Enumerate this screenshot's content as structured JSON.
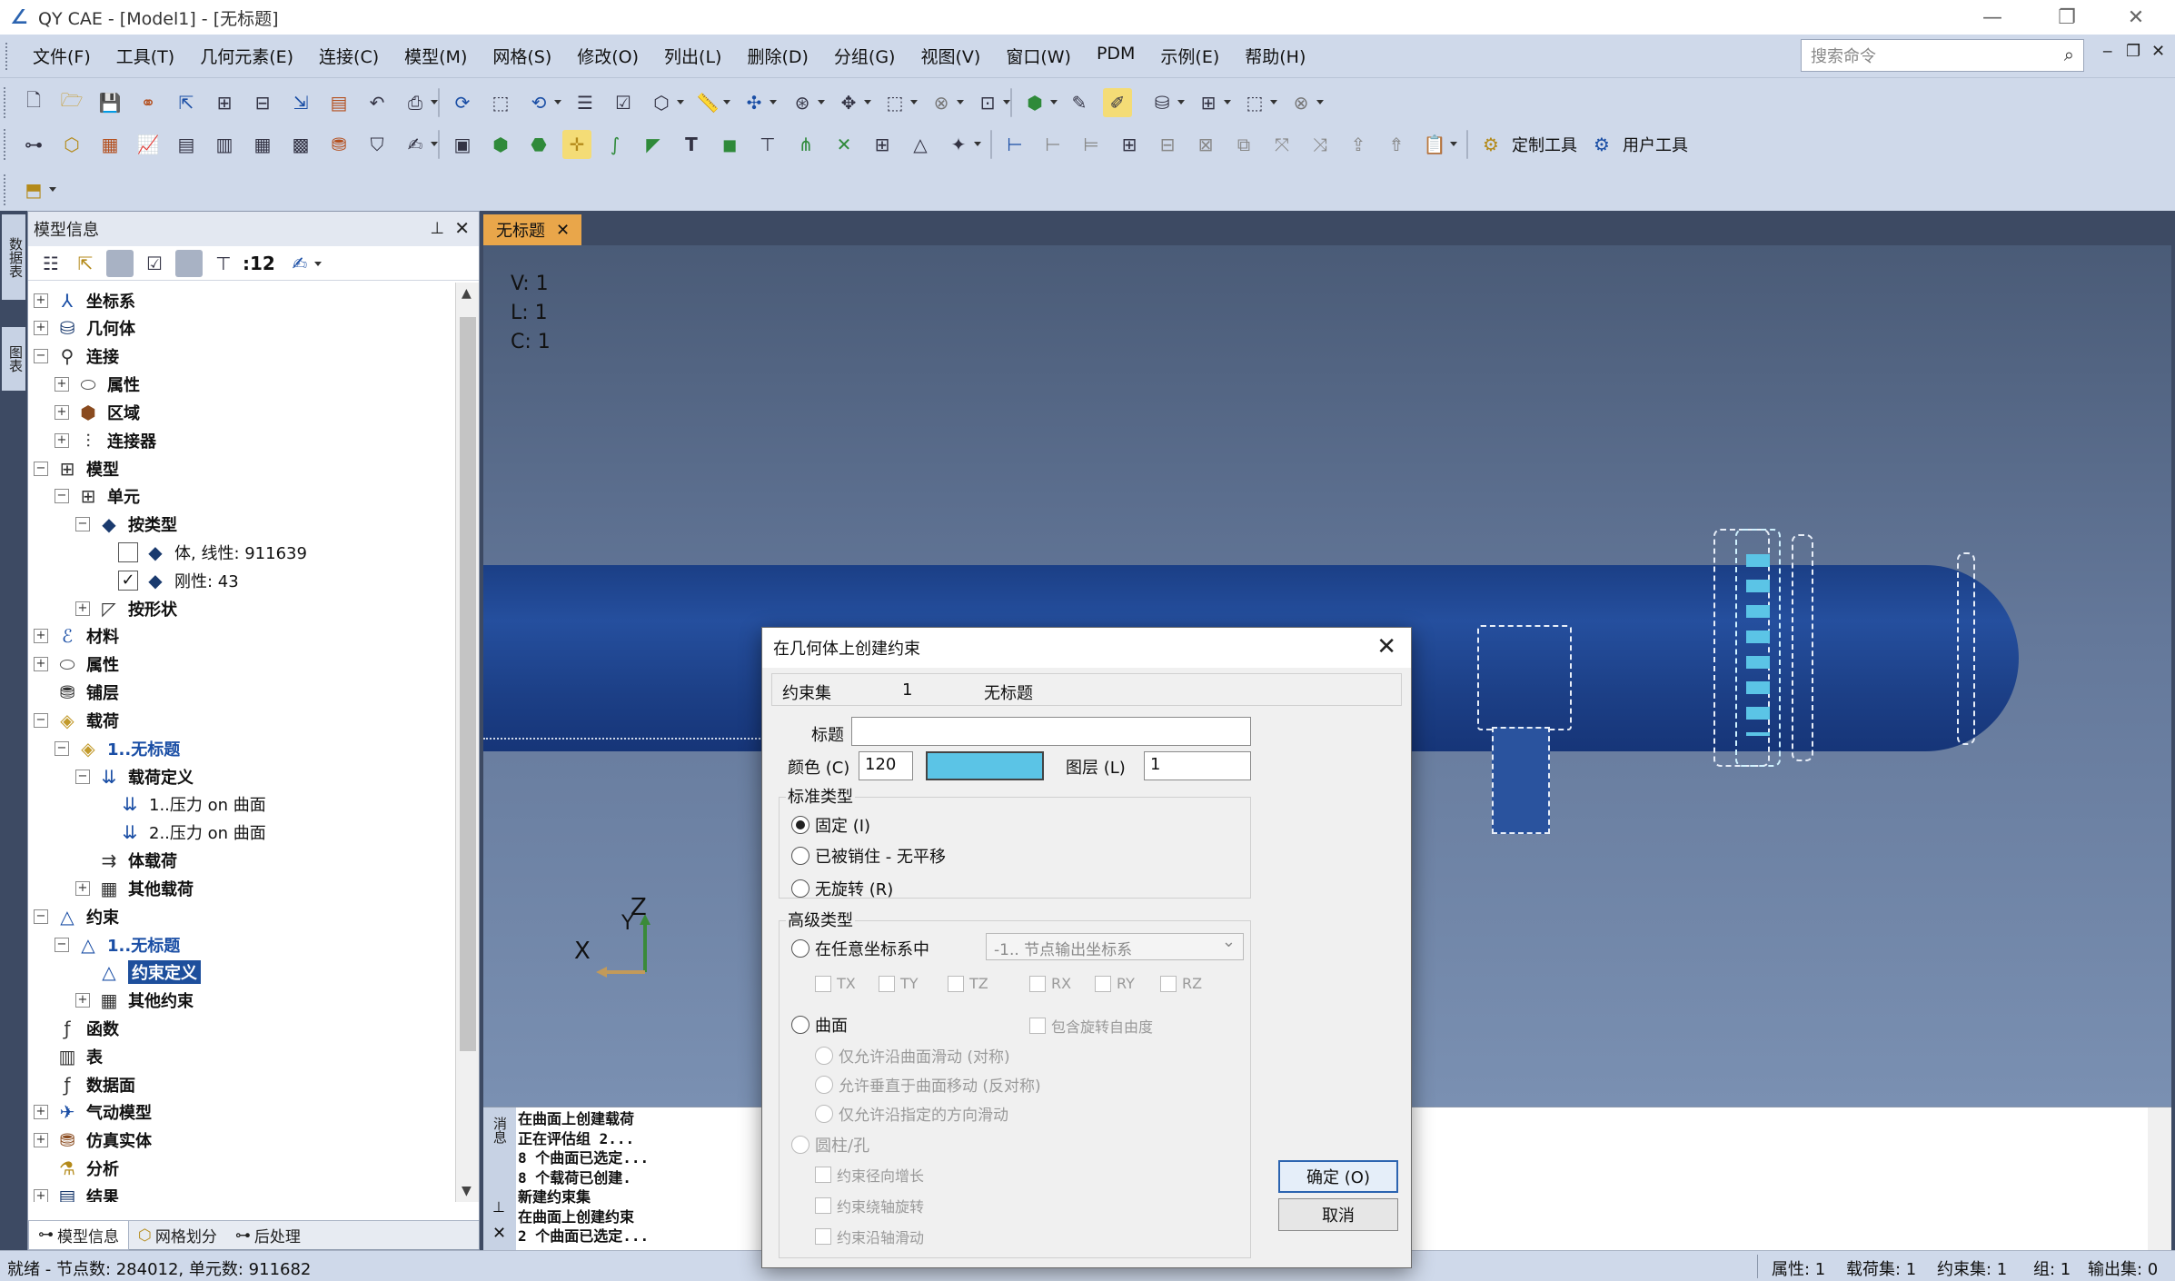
{
  "window": {
    "title": "QY CAE - [Model1] - [无标题]"
  },
  "menu": [
    "文件(F)",
    "工具(T)",
    "几何元素(E)",
    "连接(C)",
    "模型(M)",
    "网格(S)",
    "修改(O)",
    "列出(L)",
    "删除(D)",
    "分组(G)",
    "视图(V)",
    "窗口(W)",
    "PDM",
    "示例(E)",
    "帮助(H)"
  ],
  "search": {
    "placeholder": "搜索命令"
  },
  "toolbar": {
    "custom_tools": "定制工具",
    "user_tools": "用户工具"
  },
  "panel": {
    "title": "模型信息",
    "count": ":12",
    "tabs": [
      "模型信息",
      "网格划分",
      "后处理"
    ],
    "side_tabs": [
      "数据表",
      "图表"
    ]
  },
  "tree": [
    {
      "label": "坐标系",
      "icon": "axis-icon",
      "level": 0,
      "exp": "+"
    },
    {
      "label": "几何体",
      "icon": "cylinder-icon",
      "level": 0,
      "exp": "+"
    },
    {
      "label": "连接",
      "icon": "connection-icon",
      "level": 0,
      "exp": "−"
    },
    {
      "label": "属性",
      "icon": "property-icon",
      "level": 1,
      "exp": "+"
    },
    {
      "label": "区域",
      "icon": "region-icon",
      "level": 1,
      "exp": "+"
    },
    {
      "label": "连接器",
      "icon": "connector-icon",
      "level": 1,
      "exp": "+"
    },
    {
      "label": "模型",
      "icon": "model-icon",
      "level": 0,
      "exp": "−"
    },
    {
      "label": "单元",
      "icon": "element-icon",
      "level": 1,
      "exp": "−"
    },
    {
      "label": "按类型",
      "icon": "type-icon",
      "level": 2,
      "exp": "−"
    },
    {
      "label": "体, 线性: 911639",
      "icon": "solid-icon",
      "level": 3,
      "cb": false,
      "normal": true
    },
    {
      "label": "刚性: 43",
      "icon": "rigid-icon",
      "level": 3,
      "cb": true,
      "normal": true
    },
    {
      "label": "按形状",
      "icon": "shape-icon",
      "level": 2,
      "exp": "+"
    },
    {
      "label": "材料",
      "icon": "material-icon",
      "level": 0,
      "exp": "+",
      "indent": 1
    },
    {
      "label": "属性",
      "icon": "property-icon",
      "level": 0,
      "exp": "+",
      "indent": 1
    },
    {
      "label": "铺层",
      "icon": "layer-icon",
      "level": 0,
      "indent": 1
    },
    {
      "label": "载荷",
      "icon": "load-icon",
      "level": 0,
      "exp": "−",
      "indent": 1
    },
    {
      "label": "1..无标题",
      "icon": "loadset-icon",
      "level": 1,
      "exp": "−",
      "indent": 1,
      "blue": true
    },
    {
      "label": "载荷定义",
      "icon": "loaddef-icon",
      "level": 2,
      "exp": "−",
      "indent": 1
    },
    {
      "label": "1..压力 on 曲面",
      "icon": "pressure-icon",
      "level": 3,
      "indent": 1,
      "normal": true
    },
    {
      "label": "2..压力 on 曲面",
      "icon": "pressure-icon",
      "level": 3,
      "indent": 1,
      "normal": true
    },
    {
      "label": "体载荷",
      "icon": "bodyload-icon",
      "level": 2,
      "indent": 1
    },
    {
      "label": "其他载荷",
      "icon": "otherload-icon",
      "level": 2,
      "exp": "+",
      "indent": 1
    },
    {
      "label": "约束",
      "icon": "constraint-icon",
      "level": 0,
      "exp": "−",
      "indent": 1
    },
    {
      "label": "1..无标题",
      "icon": "constraint-icon",
      "level": 1,
      "exp": "−",
      "indent": 1,
      "blue": true
    },
    {
      "label": "约束定义",
      "icon": "constraint-icon",
      "level": 2,
      "indent": 1,
      "sel": true
    },
    {
      "label": "其他约束",
      "icon": "otherconstraint-icon",
      "level": 2,
      "exp": "+",
      "indent": 1
    },
    {
      "label": "函数",
      "icon": "function-icon",
      "level": 0,
      "indent": 1
    },
    {
      "label": "表",
      "icon": "table-icon",
      "level": 0,
      "indent": 1
    },
    {
      "label": "数据面",
      "icon": "datasurface-icon",
      "level": 0,
      "indent": 1
    },
    {
      "label": "气动模型",
      "icon": "aero-icon",
      "level": 0,
      "exp": "+"
    },
    {
      "label": "仿真实体",
      "icon": "entity-icon",
      "level": 0,
      "exp": "+"
    },
    {
      "label": "分析",
      "icon": "analysis-icon",
      "level": 0
    },
    {
      "label": "结果",
      "icon": "result-icon",
      "level": 0,
      "exp": "+"
    }
  ],
  "doc_tab": "无标题",
  "viewport": {
    "v": "V: 1",
    "l": "L: 1",
    "c": "C: 1",
    "axis_x": "X",
    "axis_z": "Z",
    "axis_y": "Y"
  },
  "output": {
    "side_label": "消息",
    "lines": [
      "在曲面上创建载荷",
      "正在评估组 2...",
      "8 个曲面已选定...",
      "8 个载荷已创建.",
      "新建约束集",
      "在曲面上创建约束",
      "2 个曲面已选定..."
    ]
  },
  "status": {
    "left": "就绪 - 节点数: 284012, 单元数: 911682",
    "items": [
      "属性: 1",
      "载荷集: 1",
      "约束集: 1",
      "组: 1",
      "输出集: 0"
    ]
  },
  "dialog": {
    "title": "在几何体上创建约束",
    "set_label": "约束集",
    "set_id": "1",
    "set_name": "无标题",
    "title_label": "标题",
    "title_value": "",
    "color_label": "颜色 (C)",
    "color_value": "120",
    "color_hex": "#5bc4e6",
    "layer_label": "图层 (L)",
    "layer_value": "1",
    "std_group": "标准类型",
    "std_options": [
      "固定 (I)",
      "已被销住 - 无平移",
      "无旋转 (R)"
    ],
    "adv_group": "高级类型",
    "adv_any": "在任意坐标系中",
    "adv_coord": "-1.. 节点输出坐标系",
    "dofs": [
      "TX",
      "TY",
      "TZ",
      "RX",
      "RY",
      "RZ"
    ],
    "surface": "曲面",
    "include_rot": "包含旋转自由度",
    "surface_opts": [
      "仅允许沿曲面滑动 (对称)",
      "允许垂直于曲面移动 (反对称)",
      "仅允许沿指定的方向滑动"
    ],
    "cyl": "圆柱/孔",
    "cyl_opts": [
      "约束径向增长",
      "约束绕轴旋转",
      "约束沿轴滑动"
    ],
    "ok": "确定 (O)",
    "cancel": "取消"
  }
}
